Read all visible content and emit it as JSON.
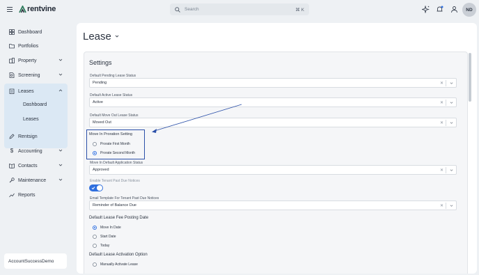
{
  "header": {
    "logo_text": "rentvine",
    "search_placeholder": "Search",
    "search_shortcut": "⌘ K",
    "avatar_initials": "ND"
  },
  "sidebar": {
    "items": [
      {
        "label": "Dashboard",
        "icon": "grid-icon"
      },
      {
        "label": "Portfolios",
        "icon": "folder-icon"
      },
      {
        "label": "Property",
        "icon": "building-icon"
      },
      {
        "label": "Screening",
        "icon": "document-search-icon"
      },
      {
        "label": "Leases",
        "icon": "clipboard-icon"
      },
      {
        "label": "Rentsign",
        "icon": "pen-icon"
      },
      {
        "label": "Accounting",
        "icon": "dollar-icon"
      },
      {
        "label": "Contacts",
        "icon": "book-icon"
      },
      {
        "label": "Maintenance",
        "icon": "wrench-icon"
      },
      {
        "label": "Reports",
        "icon": "chart-icon"
      }
    ],
    "leases_sub": [
      "Dashboard",
      "Leases"
    ],
    "account_name": "AccountSuccessDemo"
  },
  "main": {
    "page_title": "Lease",
    "settings_title": "Settings",
    "fields": {
      "pending_label": "Default Pending Lease Status",
      "pending_value": "Pending",
      "active_label": "Default Active Lease Status",
      "active_value": "Active",
      "moveout_label": "Default Move Out Lease Status",
      "moveout_value": "Moved Out",
      "proration_label": "Move In Proration Setting",
      "proration_options": [
        "Prorate First Month",
        "Prorate Second Month"
      ],
      "proration_selected": "Prorate Second Month",
      "application_label": "Move In Default Application Status",
      "application_value": "Approved",
      "past_due_label": "Enable Tenant Past Due Notices",
      "past_due_enabled": true,
      "email_template_label": "Email Template For Tenant Past Due Notices",
      "email_template_value": "Reminder of Balance Due",
      "fee_posting_label": "Default Lease Fee Posting Date",
      "fee_posting_options": [
        "Move In Date",
        "Start Date",
        "Today"
      ],
      "fee_posting_selected": "Move In Date",
      "activation_label": "Default Lease Activation Option",
      "activation_options": [
        "Manually Activate Lease"
      ]
    }
  },
  "colors": {
    "accent": "#2f6fde",
    "annotation": "#2a4fa8",
    "sidebar_active_bg": "#dbe8f4"
  }
}
